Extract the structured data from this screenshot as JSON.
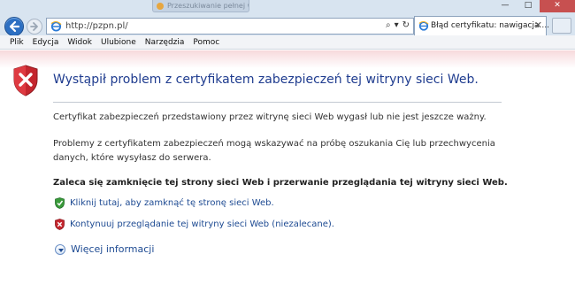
{
  "window": {
    "bg_tab_label": "Przeszukiwanie pełnej wersji",
    "min_glyph": "—",
    "max_glyph": "□",
    "close_glyph": "✕"
  },
  "addressbar": {
    "url": "http://pzpn.pl/",
    "search_glyph": "⌕",
    "dropdown_glyph": "▾",
    "refresh_glyph": "↻"
  },
  "tab": {
    "label": "Błąd certyfikatu: nawigacja ...",
    "close_glyph": "✕"
  },
  "menu": [
    "Plik",
    "Edycja",
    "Widok",
    "Ulubione",
    "Narzędzia",
    "Pomoc"
  ],
  "content": {
    "headline": "Wystąpił problem z certyfikatem zabezpieczeń tej witryny sieci Web.",
    "paragraph1": "Certyfikat zabezpieczeń przedstawiony przez witrynę sieci Web wygasł lub nie jest jeszcze ważny.",
    "paragraph2": "Problemy z certyfikatem zabezpieczeń mogą wskazywać na próbę oszukania Cię lub przechwycenia danych, które wysyłasz do serwera.",
    "recommendation": "Zaleca się zamknięcie tej strony sieci Web i przerwanie przeglądania tej witryny sieci Web.",
    "close_link": "Kliknij tutaj, aby zamknąć tę stronę sieci Web.",
    "continue_link": "Kontynuuj przeglądanie tej witryny sieci Web (niezalecane).",
    "more_info": "Więcej informacji"
  },
  "colors": {
    "link": "#1d4a92",
    "headline": "#1f3c8f",
    "shield_red": "#c4262e",
    "shield_green": "#3a9a3a"
  }
}
